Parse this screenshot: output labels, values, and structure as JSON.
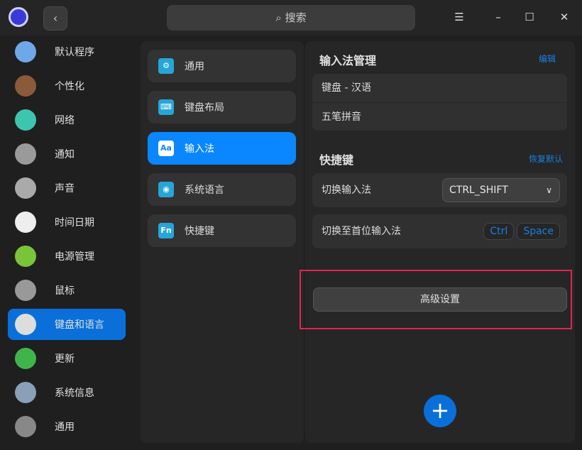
{
  "titlebar": {
    "search_placeholder": "搜索",
    "back_icon": "chevron-left-icon"
  },
  "sidebar": {
    "items": [
      {
        "label": "默认程序",
        "color": "#6fa8e8"
      },
      {
        "label": "个性化",
        "color": "#8a5a3a"
      },
      {
        "label": "网络",
        "color": "#3cc6b0"
      },
      {
        "label": "通知",
        "color": "#9a9a9a"
      },
      {
        "label": "声音",
        "color": "#aaaaaa"
      },
      {
        "label": "时间日期",
        "color": "#eeeeee"
      },
      {
        "label": "电源管理",
        "color": "#7ac43a"
      },
      {
        "label": "鼠标",
        "color": "#999999"
      },
      {
        "label": "键盘和语言",
        "color": "#dddddd",
        "active": true
      },
      {
        "label": "更新",
        "color": "#3fb44a"
      },
      {
        "label": "系统信息",
        "color": "#8aa0b8"
      },
      {
        "label": "通用",
        "color": "#888888"
      }
    ]
  },
  "subnav": {
    "items": [
      {
        "label": "通用",
        "icon": "gear-icon",
        "glyph": "⚙"
      },
      {
        "label": "键盘布局",
        "icon": "keyboard-icon",
        "glyph": "⌨"
      },
      {
        "label": "输入法",
        "icon": "input-method-icon",
        "glyph": "Aa",
        "active": true
      },
      {
        "label": "系统语言",
        "icon": "globe-icon",
        "glyph": "◉"
      },
      {
        "label": "快捷键",
        "icon": "fn-key-icon",
        "glyph": "Fn"
      }
    ]
  },
  "input_methods": {
    "title": "输入法管理",
    "edit": "编辑",
    "items": [
      "键盘 - 汉语",
      "五笔拼音"
    ]
  },
  "shortcuts": {
    "title": "快捷键",
    "restore": "恢复默认",
    "switch_label": "切换输入法",
    "switch_value": "CTRL_SHIFT",
    "first_label": "切换至首位输入法",
    "first_keys": [
      "Ctrl",
      "Space"
    ]
  },
  "advanced": "高级设置",
  "accent": "#0a87ff"
}
